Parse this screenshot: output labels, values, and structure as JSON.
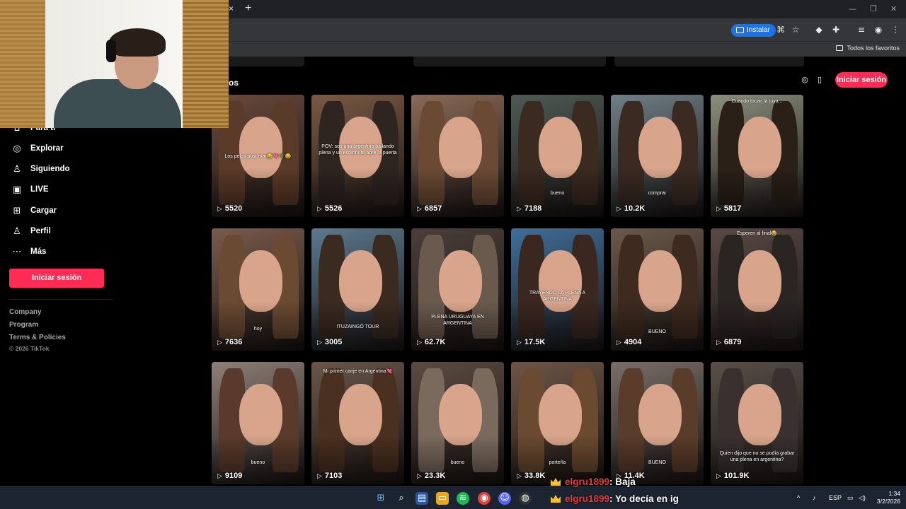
{
  "browser": {
    "new_tab": "+",
    "close_tab": "×",
    "install_label": "Instalar",
    "favorites_label": "Todos los favoritos"
  },
  "section_title": "os",
  "login_label": "Iniciar sesión",
  "sidebar": {
    "items": [
      {
        "label": "Para ti",
        "icon": "home-icon"
      },
      {
        "label": "Explorar",
        "icon": "compass-icon"
      },
      {
        "label": "Siguiendo",
        "icon": "following-icon"
      },
      {
        "label": "LIVE",
        "icon": "live-icon"
      },
      {
        "label": "Cargar",
        "icon": "upload-icon"
      },
      {
        "label": "Perfil",
        "icon": "profile-icon"
      },
      {
        "label": "Más",
        "icon": "more-icon"
      }
    ],
    "login_label": "Iniciar sesión",
    "footer_links": [
      "Company",
      "Program",
      "Terms & Policies"
    ],
    "copyright": "© 2026 TikTok"
  },
  "videos": [
    {
      "views": "5520",
      "caption": "Los pelos post mar😂💘🌴😂"
    },
    {
      "views": "5526",
      "caption": "POV: sos una argentina bailando plena y un espíritu te abre la puerta"
    },
    {
      "views": "6857",
      "caption": ""
    },
    {
      "views": "7188",
      "caption": "bueno"
    },
    {
      "views": "10.2K",
      "caption": "comprar"
    },
    {
      "views": "5817",
      "caption": "Cuando tocan la tuya..."
    },
    {
      "views": "7636",
      "caption": "hoy"
    },
    {
      "views": "3005",
      "caption": "ITUZAINGÓ TOUR"
    },
    {
      "views": "62.7K",
      "caption": "PLENA URUGUAYA EN ARGENTINA"
    },
    {
      "views": "17.5K",
      "caption": "TRAYENDO LA PLENA A ARGENTINA"
    },
    {
      "views": "4904",
      "caption": "BUENO"
    },
    {
      "views": "6879",
      "caption": "Esperen al final😂"
    },
    {
      "views": "9109",
      "caption": "bueno"
    },
    {
      "views": "7103",
      "caption": "Mi primer canje en Argentina💘"
    },
    {
      "views": "23.3K",
      "caption": "bueno"
    },
    {
      "views": "33.8K",
      "caption": "porteña"
    },
    {
      "views": "11.4K",
      "caption": "BUENO"
    },
    {
      "views": "101.9K",
      "caption": "Quien dijo que no se podía grabar una plena en argentina?"
    }
  ],
  "chat": [
    {
      "user": "elgru1899",
      "message": ": Baja"
    },
    {
      "user": "elgru1899",
      "message": ": Yo decía en ig"
    }
  ],
  "taskbar": {
    "language": "ESP",
    "time": "1:34",
    "date": "3/2/2026"
  },
  "colors": {
    "accent": "#fe2c55",
    "install_blue": "#1a73e8",
    "chat_user": "#e83a3a"
  }
}
